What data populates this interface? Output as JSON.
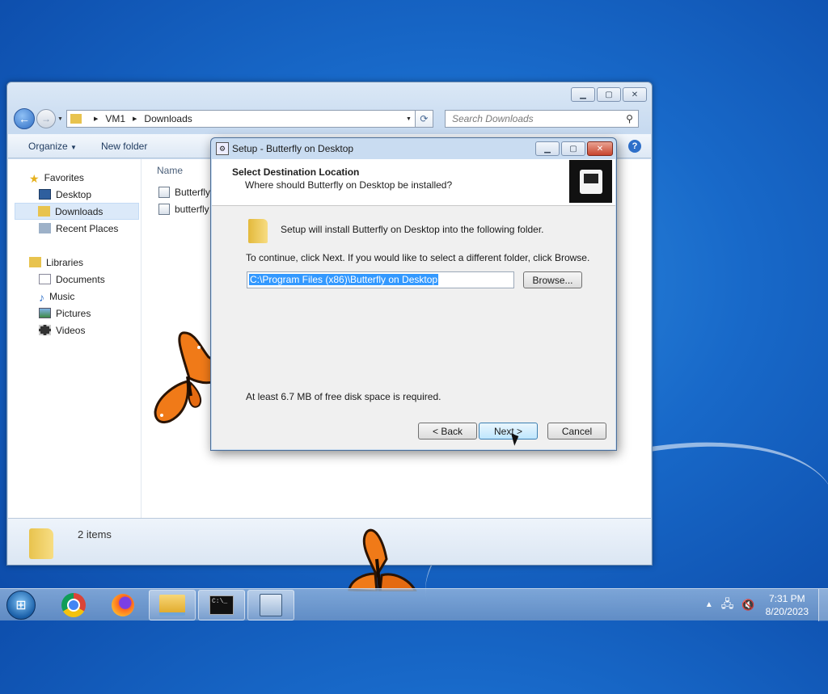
{
  "explorer": {
    "breadcrumb": [
      "VM1",
      "Downloads"
    ],
    "search_placeholder": "Search Downloads",
    "toolbar": {
      "organize": "Organize",
      "new_folder": "New folder"
    },
    "nav": {
      "favorites": "Favorites",
      "favorites_items": [
        "Desktop",
        "Downloads",
        "Recent Places"
      ],
      "libraries": "Libraries",
      "libraries_items": [
        "Documents",
        "Music",
        "Pictures",
        "Videos"
      ],
      "selected": "Downloads"
    },
    "column_name": "Name",
    "files": [
      "Butterfly",
      "butterfly"
    ],
    "status_count": "2 items"
  },
  "setup": {
    "title": "Setup - Butterfly on Desktop",
    "header_title": "Select Destination Location",
    "header_subtitle": "Where should Butterfly on Desktop be installed?",
    "install_text": "Setup will install Butterfly on Desktop into the following folder.",
    "continue_text": "To continue, click Next. If you would like to select a different folder, click Browse.",
    "path_value": "C:\\Program Files (x86)\\Butterfly on Desktop",
    "browse_label": "Browse...",
    "space_text": "At least 6.7 MB of free disk space is required.",
    "back_label": "< Back",
    "next_label": "Next >",
    "cancel_label": "Cancel"
  },
  "taskbar": {
    "apps": [
      "chrome-icon",
      "firefox-icon",
      "explorer-icon",
      "cmd-icon",
      "setup-icon"
    ],
    "active_apps": [
      "explorer-icon",
      "cmd-icon",
      "setup-icon"
    ],
    "time": "7:31 PM",
    "date": "8/20/2023"
  },
  "colors": {
    "desktop": "#1869c9",
    "selection": "#3399ff",
    "butterfly_orange": "#f07a18"
  }
}
